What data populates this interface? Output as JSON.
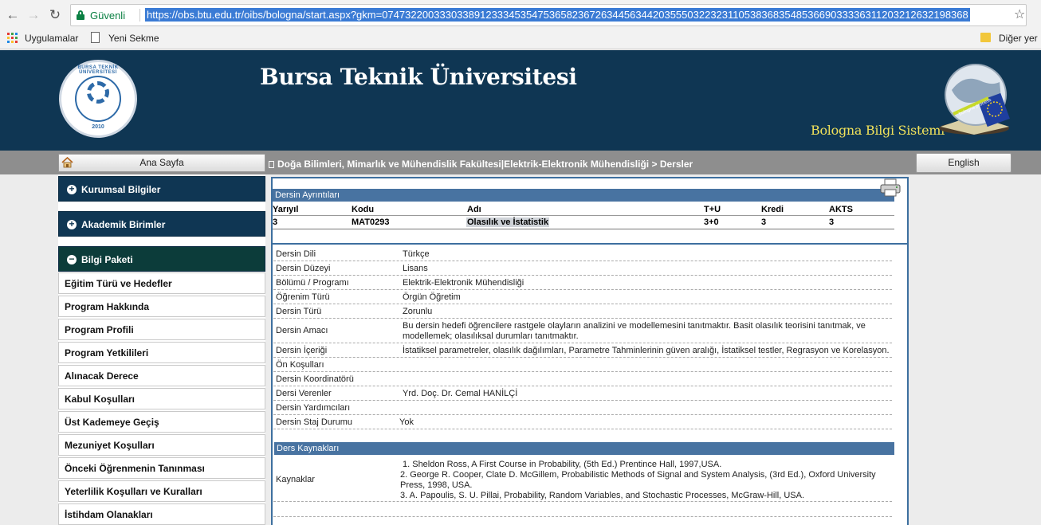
{
  "browser": {
    "security_label": "Güvenli",
    "url": "https://obs.btu.edu.tr/oibs/bologna/start.aspx?gkm=074732200333033891233345354753658236726344563442035550322323110538368354853669033336311203212632198368",
    "bookmarks": [
      "Uygulamalar",
      "Yeni Sekme",
      "Diğer yer"
    ]
  },
  "header": {
    "university": "Bursa Teknik Üniversitesi",
    "system": "Bologna Bilgi Sistemi",
    "logo_ring": "BURSA TEKNİK ÜNİVERSİTESİ",
    "logo_year": "2010",
    "globe_label": "bologna process"
  },
  "nav": {
    "home": "Ana Sayfa",
    "breadcrumb": "Doğa Bilimleri, Mimarlık ve Mühendislik Fakültesi|Elektrik-Elektronik Mühendisliği > Dersler",
    "english": "English"
  },
  "sidebar": {
    "sections": [
      "Kurumsal Bilgiler",
      "Akademik Birimler",
      "Bilgi Paketi"
    ],
    "items": [
      "Eğitim Türü ve Hedefler",
      "Program Hakkında",
      "Program Profili",
      "Program Yetkilileri",
      "Alınacak Derece",
      "Kabul Koşulları",
      "Üst Kademeye Geçiş",
      "Mezuniyet Koşulları",
      "Önceki Öğrenmenin Tanınması",
      "Yeterlilik Koşulları ve Kuralları",
      "İstihdam Olanakları"
    ]
  },
  "course": {
    "section_title": "Dersin Ayrıntıları",
    "headers": {
      "semester": "Yarıyıl",
      "code": "Kodu",
      "name": "Adı",
      "tu": "T+U",
      "credit": "Kredi",
      "ects": "AKTS"
    },
    "values": {
      "semester": "3",
      "code": "MAT0293",
      "name": "Olasılık ve İstatistik",
      "tu": "3+0",
      "credit": "3",
      "ects": "3"
    },
    "details": [
      {
        "label": "Dersin Dili",
        "value": "Türkçe"
      },
      {
        "label": "Dersin Düzeyi",
        "value": "Lisans"
      },
      {
        "label": "Bölümü / Programı",
        "value": "Elektrik-Elektronik Mühendisliği"
      },
      {
        "label": "Öğrenim Türü",
        "value": "Örgün Öğretim"
      },
      {
        "label": "Dersin Türü",
        "value": "Zorunlu"
      },
      {
        "label": "Dersin Amacı",
        "value": " Bu dersin hedefi öğrencilere rastgele olayların analizini ve modellemesini tanıtmaktır. Basit olasılık teorisini tanıtmak, ve modellemek; olasılıksal durumları tanıtmaktır."
      },
      {
        "label": "Dersin İçeriği",
        "value": "İstatiksel parametreler, olasılık dağılımları, Parametre Tahminlerinin güven aralığı, İstatiksel testler, Regrasyon ve Korelasyon."
      },
      {
        "label": "Ön Koşulları",
        "value": ""
      },
      {
        "label": "Dersin Koordinatörü",
        "value": ""
      },
      {
        "label": "Dersi Verenler",
        "value": "Yrd. Doç. Dr. Cemal HANİLÇİ"
      },
      {
        "label": "Dersin Yardımcıları",
        "value": ""
      },
      {
        "label": "Dersin Staj Durumu",
        "value": "Yok"
      }
    ],
    "resources_title": "Ders Kaynakları",
    "resources_label": "Kaynaklar",
    "resources": [
      "1. Sheldon Ross, A First Course in Probability, (5th Ed.) Prentince Hall, 1997,USA.",
      "2. George R. Cooper, Clate D. McGillem, Probabilistic Methods of Signal and System Analysis, (3rd Ed.), Oxford University Press, 1998, USA.",
      "3. A. Papoulis, S. U. Pillai, Probability, Random Variables, and Stochastic Processes, McGraw-Hill, USA."
    ]
  },
  "colors": {
    "banner": "#0f3653",
    "bar": "#4873a1",
    "secure": "#0b8043",
    "title_yellow": "#f0e15a"
  }
}
